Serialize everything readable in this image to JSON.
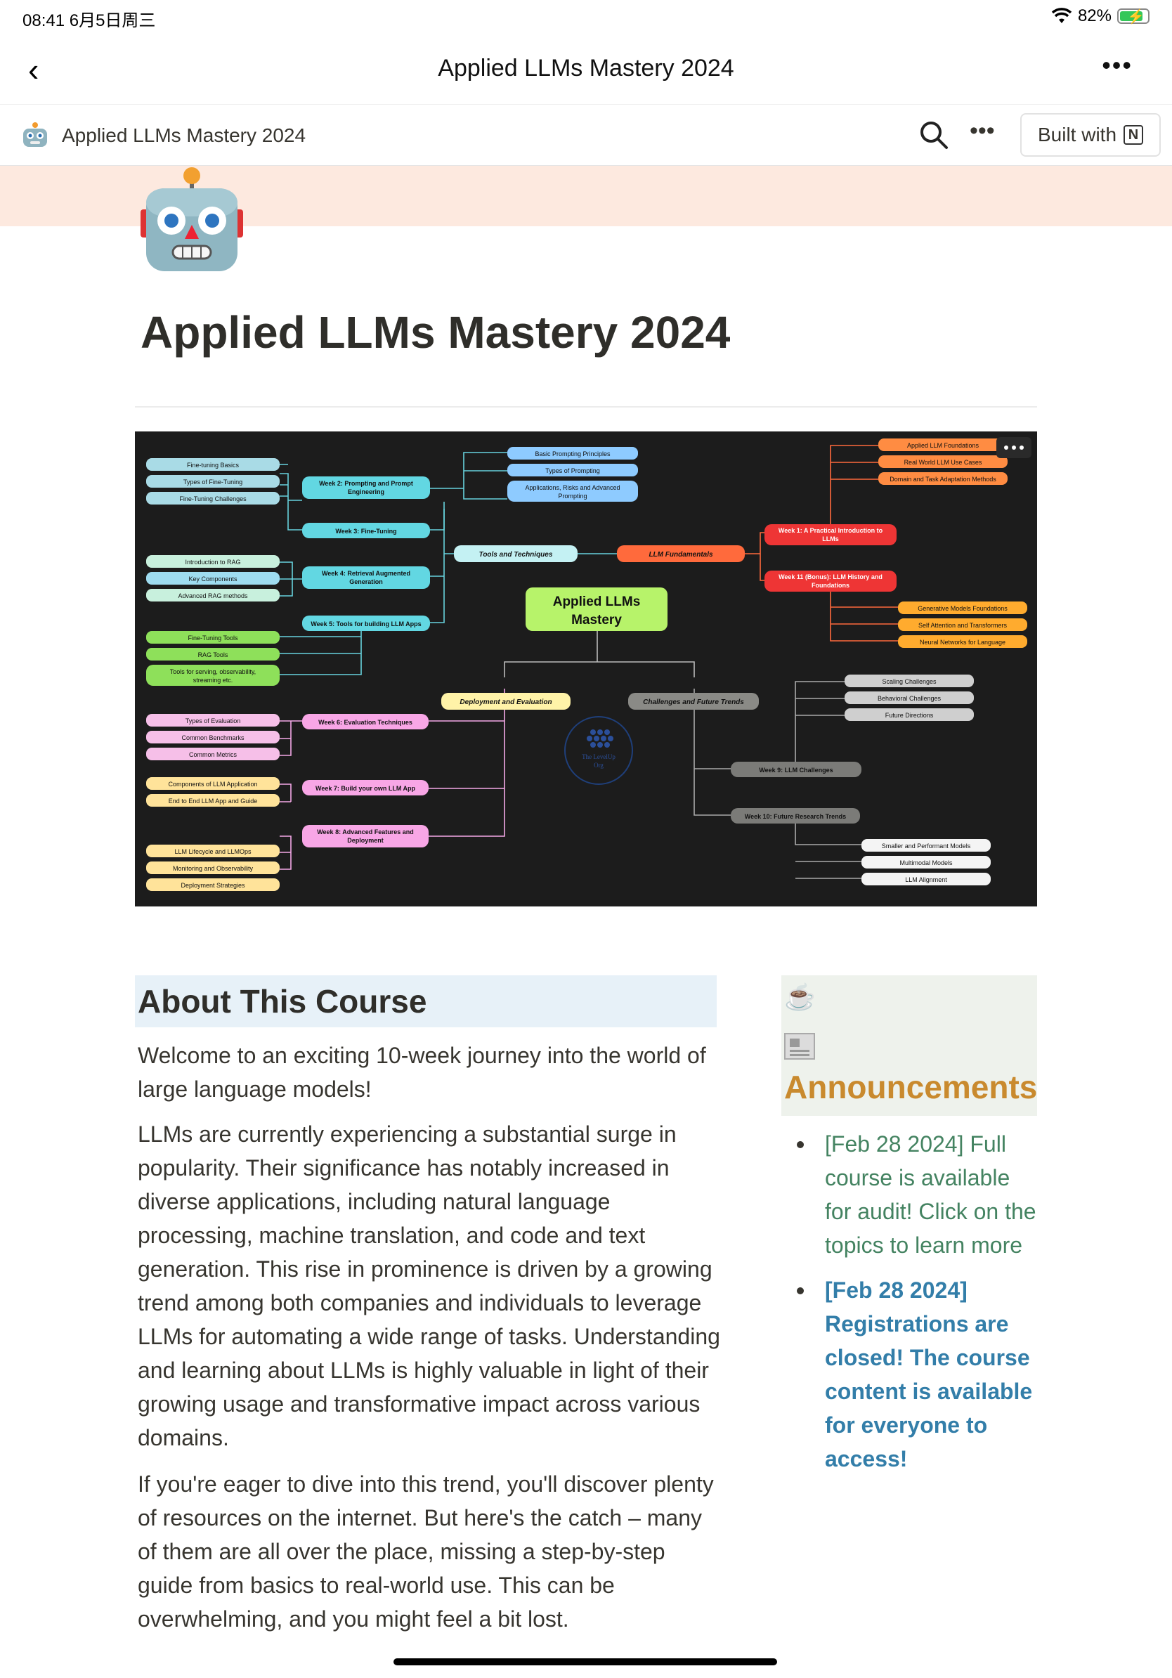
{
  "status_bar": {
    "time": "08:41",
    "date": "6月5日周三",
    "battery": "82%"
  },
  "nav": {
    "title": "Applied LLMs Mastery 2024"
  },
  "notion_bar": {
    "page_title": "Applied LLMs Mastery 2024",
    "built_with": "Built with"
  },
  "page": {
    "title": "Applied LLMs Mastery 2024"
  },
  "mindmap": {
    "center": [
      "Applied LLMs",
      "Mastery"
    ],
    "tools_and_techniques": "Tools and Techniques",
    "llm_fundamentals": "LLM Fundamentals",
    "deployment_and_evaluation": "Deployment and Evaluation",
    "challenges_and_future_trends": "Challenges and Future Trends",
    "week1": [
      "Week 1: A Practical Introduction to",
      "LLMs"
    ],
    "week1_items": [
      "Applied LLM Foundations",
      "Real World LLM Use Cases",
      "Domain and Task Adaptation Methods"
    ],
    "week11": [
      "Week 11 (Bonus): LLM History and",
      "Foundations"
    ],
    "week11_items": [
      "Generative Models Foundations",
      "Self Attention and Transformers",
      "Neural Networks for Language"
    ],
    "week2": [
      "Week 2: Prompting and Prompt",
      "Engineering"
    ],
    "week2_items": [
      [
        "Basic Prompting Principles"
      ],
      [
        "Types of Prompting"
      ],
      [
        "Applications, Risks and Advanced",
        "Prompting"
      ]
    ],
    "week3": "Week 3: Fine-Tuning",
    "week3_items": [
      "Fine-tuning Basics",
      "Types of Fine-Tuning",
      "Fine-Tuning Challenges"
    ],
    "week4": [
      "Week 4: Retrieval Augmented",
      "Generation"
    ],
    "week4_items": [
      "Introduction to RAG",
      "Key Components",
      "Advanced RAG methods"
    ],
    "week5": "Week 5: Tools for building LLM Apps",
    "week5_items": [
      [
        "Fine-Tuning Tools"
      ],
      [
        "RAG Tools"
      ],
      [
        "Tools for serving, observability,",
        "streaming etc."
      ]
    ],
    "week6": "Week 6: Evaluation Techniques",
    "week6_items": [
      "Types of Evaluation",
      "Common Benchmarks",
      "Common Metrics"
    ],
    "week7": "Week 7: Build your own LLM App",
    "week7_items": [
      "Components of LLM Application",
      "End to End LLM App and Guide"
    ],
    "week8": [
      "Week 8: Advanced Features and",
      "Deployment"
    ],
    "week8_items": [
      "LLM Lifecycle and LLMOps",
      "Monitoring and Observability",
      "Deployment Strategies"
    ],
    "week9": "Week 9: LLM Challenges",
    "week9_items": [
      "Scaling Challenges",
      "Behavioral Challenges",
      "Future Directions"
    ],
    "week10": "Week 10: Future Research Trends",
    "week10_items": [
      "Smaller and Performant Models",
      "Multimodal Models",
      "LLM Alignment"
    ],
    "logo_text": [
      "The LevelUp",
      "Org"
    ]
  },
  "about": {
    "heading": "About This Course",
    "p1": "Welcome to an exciting 10-week journey into the world of large language models!",
    "p2": "LLMs are currently experiencing a substantial surge in popularity. Their significance has notably increased in diverse applications, including natural language processing, machine translation, and code and text generation. This rise in prominence is driven by a growing trend among both companies and individuals to leverage LLMs for automating a wide range of tasks. Understanding and learning about LLMs is highly valuable in light of their growing usage and transformative impact across various domains.",
    "p3": "If you're eager to dive into this trend, you'll discover plenty of resources on the internet. But here's the catch – many of them are all over the place, missing a step-by-step guide from basics to real-world use. This can be overwhelming, and you might feel a bit lost."
  },
  "announcements": {
    "cup_icon": "☕",
    "heading": "Announcements",
    "items": [
      "[Feb 28 2024] Full course is available for audit! Click on the topics to learn more",
      "[Feb 28 2024] Registrations are closed! The course content is available for everyone to access!"
    ]
  }
}
